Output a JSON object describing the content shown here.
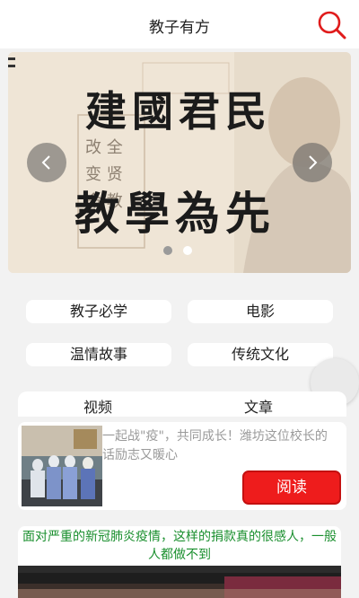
{
  "header": {
    "title": "教子有方",
    "search_icon": "search-icon",
    "search_color": "#e01b1b"
  },
  "banner": {
    "calligraphy_line1": "建國君民",
    "calligraphy_line2": "教學為先",
    "prev_icon": "chevron-left-icon",
    "next_icon": "chevron-right-icon",
    "slide_count": 2,
    "active_slide": 1
  },
  "categories": [
    {
      "label": "教子必学"
    },
    {
      "label": "电影"
    },
    {
      "label": "温情故事"
    },
    {
      "label": "传统文化"
    }
  ],
  "tabs": [
    {
      "label": "视频"
    },
    {
      "label": "文章"
    }
  ],
  "articles": [
    {
      "headline": "一起战\"疫\"，共同成长！潍坊这位校长的话励志又暖心",
      "button_label": "阅读"
    }
  ],
  "video": {
    "caption": "面对严重的新冠肺炎疫情，这样的捐款真的很感人，一般人都做不到"
  },
  "colors": {
    "accent": "#ee1c1c",
    "caption_green": "#1a8f2e"
  }
}
